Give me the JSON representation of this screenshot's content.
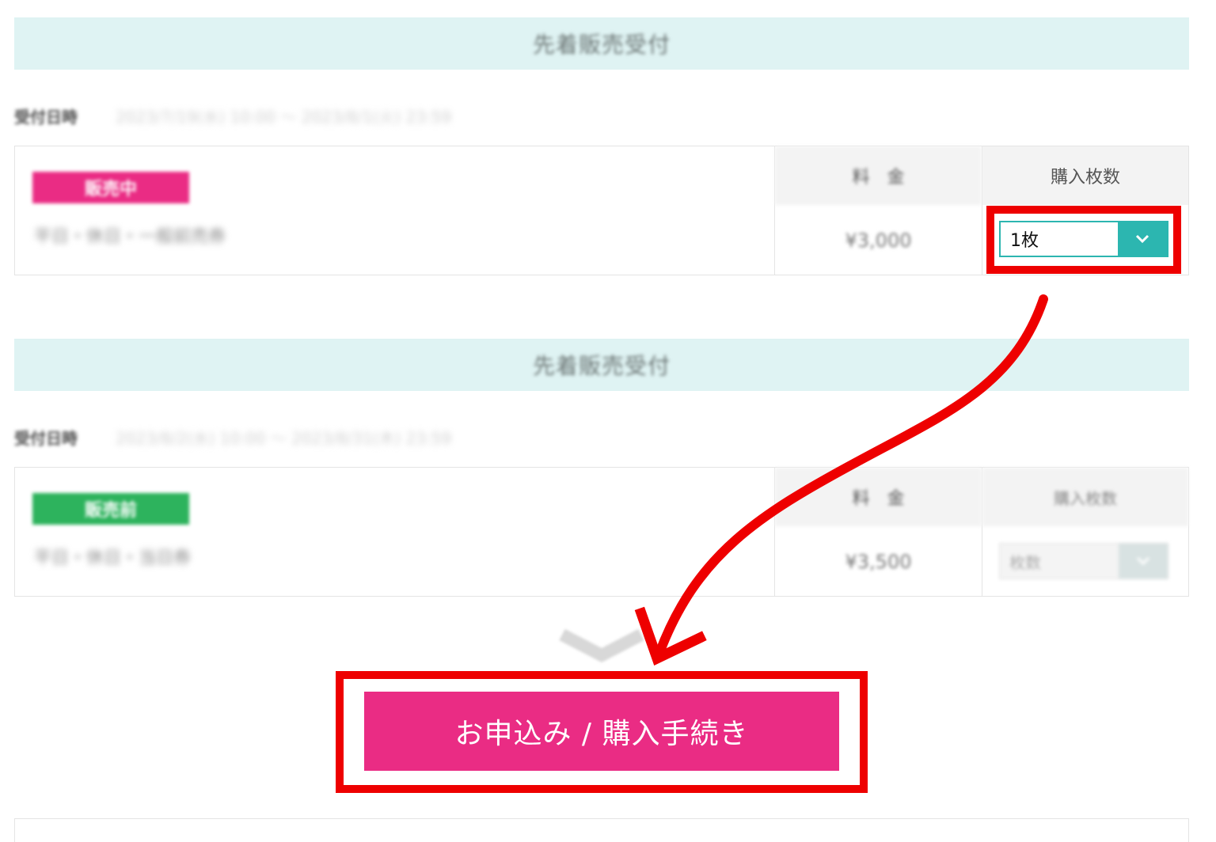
{
  "section1": {
    "header": "先着販売受付",
    "reception_label": "受付日時",
    "reception_dates": "2023/7/19(水) 10:00 〜 2023/8/1(火) 23:59",
    "status": "販売中",
    "ticket_name": "平日・休日・一般前売券",
    "price_header": "料　金",
    "price": "¥3,000",
    "qty_header": "購入枚数",
    "qty_value": "1枚"
  },
  "section2": {
    "header": "先着販売受付",
    "reception_label": "受付日時",
    "reception_dates": "2023/8/2(水) 10:00 〜 2023/8/31(木) 23:59",
    "status": "販売前",
    "ticket_name": "平日・休日・当日券",
    "price_header": "料　金",
    "price": "¥3,500",
    "qty_header": "購入枚数",
    "qty_placeholder": "枚数"
  },
  "cta": {
    "label": "お申込み / 購入手続き"
  },
  "colors": {
    "header_bg": "#dff3f3",
    "on_sale_badge": "#ea2c84",
    "before_sale_badge": "#2db35d",
    "accent_teal": "#2cb6b0",
    "cta_bg": "#ea2c84",
    "annotation_red": "#ee0000"
  },
  "icons": [
    "chevron-down-icon",
    "scroll-down-chevron-icon",
    "annotation-arrow-icon"
  ]
}
